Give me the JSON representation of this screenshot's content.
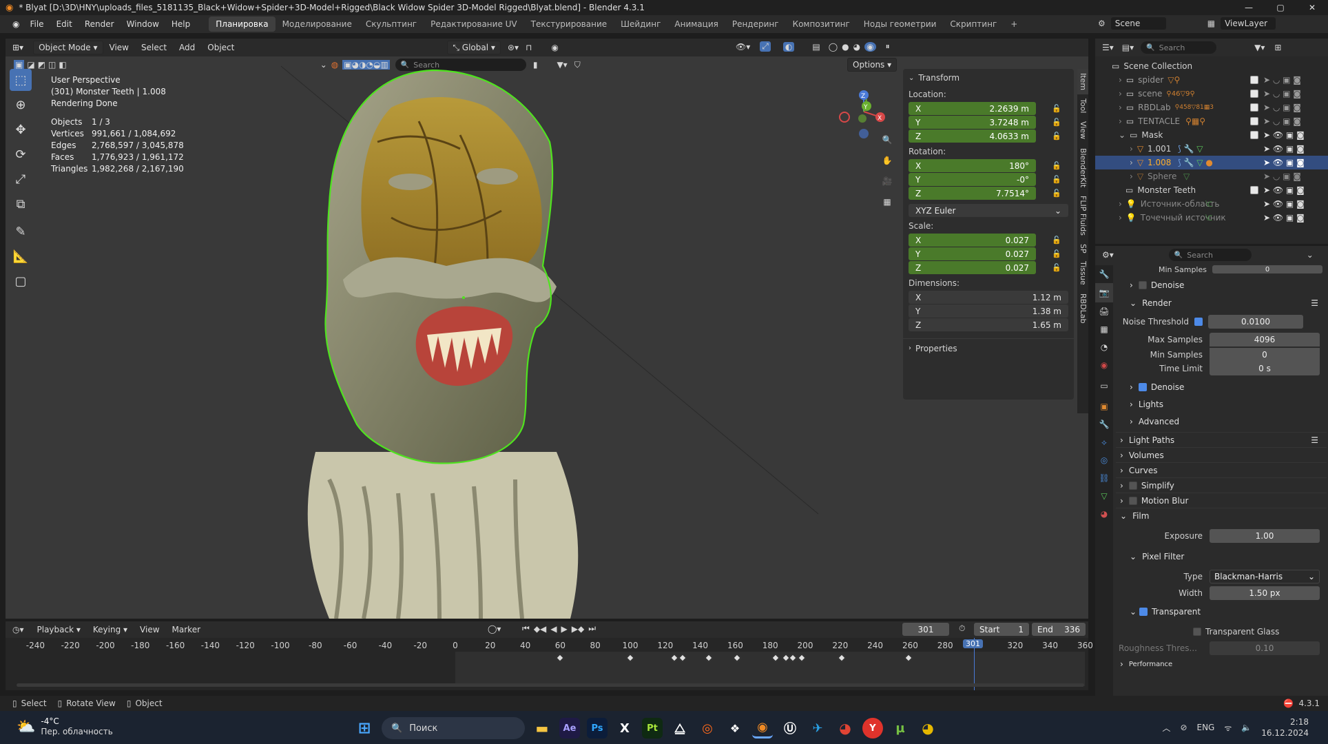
{
  "window": {
    "title": "* Blyat [D:\\3D\\HNY\\uploads_files_5181135_Black+Widow+Spider+3D-Model+Rigged\\Black Widow Spider 3D-Model Rigged\\Blyat.blend] - Blender 4.3.1"
  },
  "menu": [
    "File",
    "Edit",
    "Render",
    "Window",
    "Help"
  ],
  "workspaces": [
    "Планировка",
    "Моделирование",
    "Скульптинг",
    "Редактирование UV",
    "Текстурирование",
    "Шейдинг",
    "Анимация",
    "Рендеринг",
    "Композитинг",
    "Ноды геометрии",
    "Скриптинг"
  ],
  "active_workspace": "Планировка",
  "scene": {
    "name": "Scene",
    "view_layer": "ViewLayer"
  },
  "viewport_header": {
    "mode": "Object Mode",
    "menus": [
      "View",
      "Select",
      "Add",
      "Object"
    ],
    "orientation": "Global",
    "search_placeholder": "Search",
    "options": "Options"
  },
  "viewport_info": {
    "perspective": "User Perspective",
    "object": "(301) Monster Teeth | 1.008",
    "status": "Rendering Done",
    "stats": [
      {
        "label": "Objects",
        "value": "1 / 3"
      },
      {
        "label": "Vertices",
        "value": "991,661 / 1,084,692"
      },
      {
        "label": "Edges",
        "value": "2,768,597 / 3,045,878"
      },
      {
        "label": "Faces",
        "value": "1,776,923 / 1,961,172"
      },
      {
        "label": "Triangles",
        "value": "1,982,268 / 2,167,190"
      }
    ]
  },
  "transform": {
    "title": "Transform",
    "location_label": "Location:",
    "location": {
      "x": "2.2639 m",
      "y": "3.7248 m",
      "z": "4.0633 m"
    },
    "rotation_label": "Rotation:",
    "rotation": {
      "x": "180°",
      "y": "-0°",
      "z": "7.7514°"
    },
    "rotation_mode": "XYZ Euler",
    "scale_label": "Scale:",
    "scale": {
      "x": "0.027",
      "y": "0.027",
      "z": "0.027"
    },
    "dimensions_label": "Dimensions:",
    "dimensions": {
      "x": "1.12 m",
      "y": "1.38 m",
      "z": "1.65 m"
    },
    "properties": "Properties"
  },
  "sidebar_tabs": [
    "Item",
    "Tool",
    "View",
    "BlenderKit",
    "FLIP Fluids",
    "SP",
    "Tissue",
    "RBDLab"
  ],
  "outliner": {
    "search_placeholder": "Search",
    "collection": "Scene Collection",
    "items": [
      {
        "name": "spider",
        "badge": ""
      },
      {
        "name": "scene",
        "badge": "46"
      },
      {
        "name": "RBDLab",
        "badge": "458"
      },
      {
        "name": "TENTACLE",
        "badge": ""
      },
      {
        "name": "Mask",
        "badge": ""
      },
      {
        "name": "1.001",
        "badge": ""
      },
      {
        "name": "1.008",
        "badge": ""
      },
      {
        "name": "Sphere",
        "badge": ""
      },
      {
        "name": "Monster Teeth",
        "badge": ""
      },
      {
        "name": "Источник-область",
        "badge": ""
      },
      {
        "name": "Точечный источник",
        "badge": ""
      }
    ],
    "extra_badges": {
      "scene_b": "9",
      "rbd_b": "81",
      "rbd_c": "3"
    }
  },
  "properties": {
    "search_placeholder": "Search",
    "min_samples_top_label": "Min Samples",
    "min_samples_top": "0",
    "denoise_viewport": "Denoise",
    "render_section": "Render",
    "noise_threshold_label": "Noise Threshold",
    "noise_threshold": "0.0100",
    "max_samples_label": "Max Samples",
    "max_samples": "4096",
    "min_samples_label": "Min Samples",
    "min_samples": "0",
    "time_limit_label": "Time Limit",
    "time_limit": "0 s",
    "denoise": "Denoise",
    "lights": "Lights",
    "advanced": "Advanced",
    "light_paths": "Light Paths",
    "volumes": "Volumes",
    "curves": "Curves",
    "simplify": "Simplify",
    "motion_blur": "Motion Blur",
    "film": "Film",
    "exposure_label": "Exposure",
    "exposure": "1.00",
    "pixel_filter": "Pixel Filter",
    "type_label": "Type",
    "type_value": "Blackman-Harris",
    "width_label": "Width",
    "width_value": "1.50 px",
    "transparent": "Transparent",
    "transparent_glass": "Transparent Glass",
    "roughness_label": "Roughness Thres...",
    "roughness_value": "0.10",
    "performance": "Performance"
  },
  "timeline": {
    "menus": [
      "Playback",
      "Keying",
      "View",
      "Marker"
    ],
    "current_frame": "301",
    "start_label": "Start",
    "start": "1",
    "end_label": "End",
    "end": "336",
    "ruler": [
      "-240",
      "-220",
      "-200",
      "-180",
      "-160",
      "-140",
      "-120",
      "-100",
      "-80",
      "-60",
      "-40",
      "-20",
      "0",
      "20",
      "40",
      "60",
      "80",
      "100",
      "120",
      "140",
      "160",
      "180",
      "200",
      "220",
      "240",
      "260",
      "280",
      "320",
      "340",
      "360"
    ],
    "keyframes": [
      60,
      100,
      125,
      130,
      145,
      161,
      183,
      189,
      193,
      198,
      221,
      259
    ]
  },
  "statusbar": {
    "select": "Select",
    "rotate": "Rotate View",
    "object": "Object",
    "version": "4.3.1"
  },
  "taskbar": {
    "temp": "-4°C",
    "weather": "Пер. облачность",
    "search": "Поиск",
    "lang": "ENG",
    "time": "2:18",
    "date": "16.12.2024",
    "apps": [
      "Ae",
      "Ps",
      "X",
      "Pt"
    ]
  },
  "colors": {
    "accent": "#4772b3",
    "selection_outline": "#4fe31f",
    "field_green": "#4a7a2a"
  }
}
